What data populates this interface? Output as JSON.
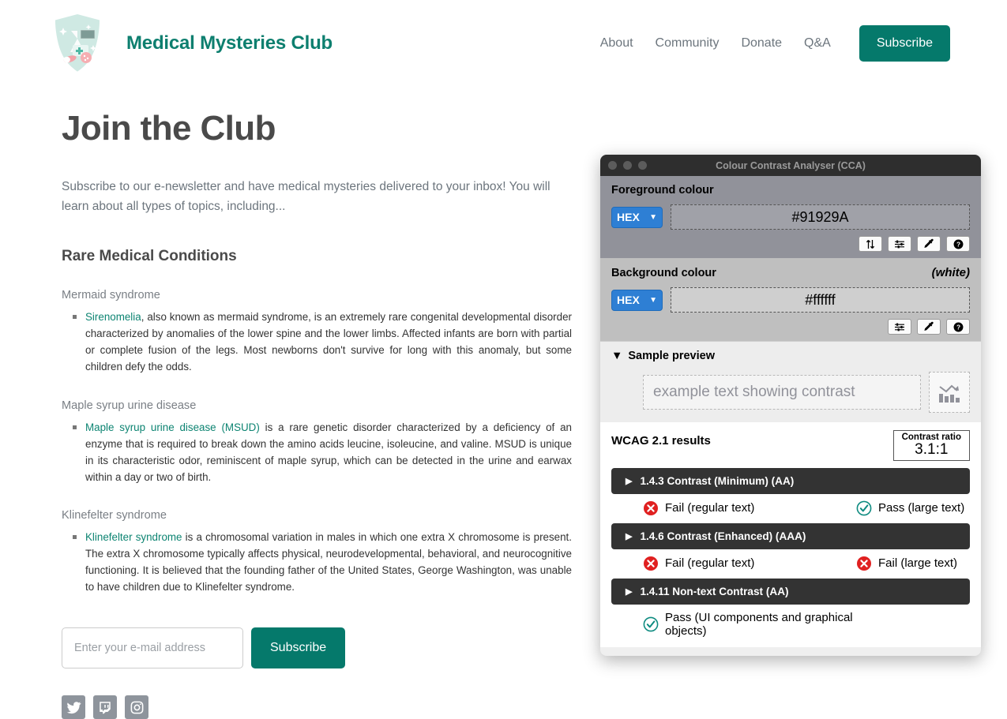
{
  "header": {
    "brand": "Medical Mysteries Club",
    "logo_icon": "medical-shield-logo",
    "nav": [
      {
        "label": "About"
      },
      {
        "label": "Community"
      },
      {
        "label": "Donate"
      },
      {
        "label": "Q&A"
      }
    ],
    "subscribe_label": "Subscribe"
  },
  "main": {
    "page_title": "Join the Club",
    "intro": "Subscribe to our e-newsletter and have medical mysteries delivered to your inbox! You will learn about all types of topics, including...",
    "section_heading": "Rare Medical Conditions",
    "conditions": [
      {
        "title": "Mermaid syndrome",
        "link_text": "Sirenomelia",
        "body": ", also known as mermaid syndrome, is an extremely rare congenital developmental disorder characterized by anomalies of the lower spine and the lower limbs. Affected infants are born with partial or complete fusion of the legs. Most newborns don't survive for long with this anomaly, but some children defy the odds."
      },
      {
        "title": "Maple syrup urine disease",
        "link_text": "Maple syrup urine disease (MSUD)",
        "body": " is a rare genetic disorder characterized by a deficiency of an enzyme that is required to break down the amino acids leucine, isoleucine, and valine. MSUD is unique in its characteristic odor, reminiscent of maple syrup, which can be detected in the urine and earwax within a day or two of birth."
      },
      {
        "title": "Klinefelter syndrome",
        "link_text": "Klinefelter syndrome",
        "body": " is a chromosomal variation in males in which one extra X chromosome is present. The extra X chromosome typically affects physical, neurodevelopmental, behavioral, and neurocognitive functioning. It is believed that the founding father of the United States, George Washington, was unable to have children due to Klinefelter syndrome."
      }
    ],
    "email_placeholder": "Enter your e-mail address",
    "email_value": "",
    "subscribe_label": "Subscribe",
    "social": [
      {
        "icon": "twitter-icon"
      },
      {
        "icon": "twitch-icon"
      },
      {
        "icon": "instagram-icon"
      }
    ]
  },
  "cca": {
    "window_title": "Colour Contrast Analyser (CCA)",
    "foreground": {
      "label": "Foreground colour",
      "format": "HEX",
      "value": "#91929A",
      "tools": [
        "swap-colours-icon",
        "sliders-icon",
        "eyedropper-icon",
        "help-icon"
      ]
    },
    "background": {
      "label": "Background colour",
      "note": "(white)",
      "format": "HEX",
      "value": "#ffffff",
      "tools": [
        "sliders-icon",
        "eyedropper-icon",
        "help-icon"
      ]
    },
    "sample": {
      "header": "Sample preview",
      "disclosure": "▼",
      "text": "example text showing contrast",
      "chart_icon": "declining-bar-chart-icon"
    },
    "wcag": {
      "title": "WCAG 2.1 results",
      "ratio_label": "Contrast ratio",
      "ratio_value": "3.1:1",
      "groups": [
        {
          "title": "1.4.3 Contrast (Minimum) (AA)",
          "disclosure": "▶",
          "results": [
            {
              "status": "fail",
              "text": "Fail (regular text)"
            },
            {
              "status": "pass",
              "text": "Pass (large text)"
            }
          ]
        },
        {
          "title": "1.4.6 Contrast (Enhanced) (AAA)",
          "disclosure": "▶",
          "results": [
            {
              "status": "fail",
              "text": "Fail (regular text)"
            },
            {
              "status": "fail",
              "text": "Fail (large text)"
            }
          ]
        },
        {
          "title": "1.4.11 Non-text Contrast (AA)",
          "disclosure": "▶",
          "results": [
            {
              "status": "pass",
              "text": "Pass (UI components and graphical objects)"
            }
          ]
        }
      ]
    }
  },
  "colors": {
    "brand_teal": "#0d7f6f",
    "button_green": "#05796b",
    "link_teal": "#0d8472",
    "fail_red": "#e02020",
    "pass_teal": "#0e8b80",
    "foreground_sample": "#91929a"
  }
}
